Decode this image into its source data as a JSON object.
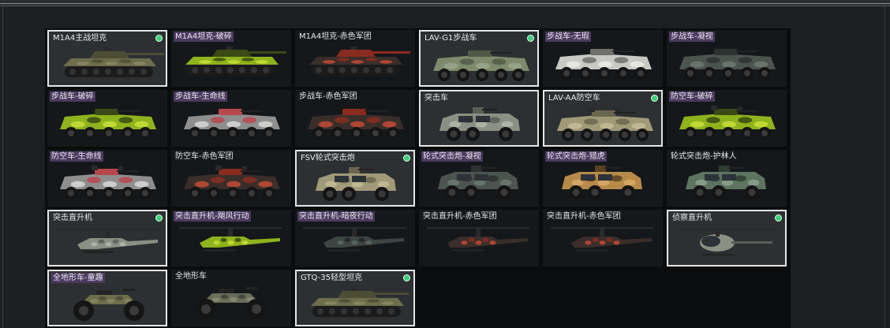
{
  "vehicles": [
    {
      "name": "M1A4主战坦克",
      "kind": "tank",
      "camo": "olive",
      "selected": true,
      "equipped": true,
      "tagged": false
    },
    {
      "name": "M1A4坦克-破碎",
      "kind": "tank",
      "camo": "lime",
      "selected": false,
      "equipped": false,
      "tagged": true
    },
    {
      "name": "M1A4坦克-赤色军团",
      "kind": "tank",
      "camo": "red",
      "selected": false,
      "equipped": false,
      "tagged": false
    },
    {
      "name": "LAV-G1步战车",
      "kind": "ifv",
      "camo": "green",
      "selected": true,
      "equipped": true,
      "tagged": false
    },
    {
      "name": "步战车-无瑕",
      "kind": "ifv",
      "camo": "white",
      "selected": false,
      "equipped": false,
      "tagged": true
    },
    {
      "name": "步战车-凝视",
      "kind": "ifv",
      "camo": "dark",
      "selected": false,
      "equipped": false,
      "tagged": true
    },
    {
      "name": "步战车-破碎",
      "kind": "ifv",
      "camo": "lime",
      "selected": false,
      "equipped": false,
      "tagged": true
    },
    {
      "name": "步战车-生命线",
      "kind": "ifv",
      "camo": "lifeline",
      "selected": false,
      "equipped": false,
      "tagged": true
    },
    {
      "name": "步战车-赤色军团",
      "kind": "ifv",
      "camo": "red",
      "selected": false,
      "equipped": false,
      "tagged": false
    },
    {
      "name": "突击车",
      "kind": "assault",
      "camo": "grey",
      "selected": true,
      "equipped": false,
      "tagged": false
    },
    {
      "name": "LAV-AA防空车",
      "kind": "aa",
      "camo": "tan",
      "selected": true,
      "equipped": true,
      "tagged": false
    },
    {
      "name": "防空车-破碎",
      "kind": "aa",
      "camo": "lime",
      "selected": false,
      "equipped": false,
      "tagged": true
    },
    {
      "name": "防空车-生命线",
      "kind": "aa",
      "camo": "lifeline",
      "selected": false,
      "equipped": false,
      "tagged": true
    },
    {
      "name": "防空车-赤色军团",
      "kind": "aa",
      "camo": "red",
      "selected": false,
      "equipped": false,
      "tagged": false
    },
    {
      "name": "FSV轮式突击炮",
      "kind": "fsv",
      "camo": "tan",
      "selected": true,
      "equipped": true,
      "tagged": false
    },
    {
      "name": "轮式突击炮-凝视",
      "kind": "fsv",
      "camo": "dark",
      "selected": false,
      "equipped": false,
      "tagged": true
    },
    {
      "name": "轮式突击炮-猎虎",
      "kind": "fsv",
      "camo": "tiger",
      "selected": false,
      "equipped": false,
      "tagged": true
    },
    {
      "name": "轮式突击炮-护林人",
      "kind": "fsv",
      "camo": "forest",
      "selected": false,
      "equipped": false,
      "tagged": false
    },
    {
      "name": "突击直升机",
      "kind": "heli",
      "camo": "grey",
      "selected": true,
      "equipped": true,
      "tagged": false
    },
    {
      "name": "突击直升机-飓风行动",
      "kind": "heli",
      "camo": "lime",
      "selected": false,
      "equipped": false,
      "tagged": true
    },
    {
      "name": "突击直升机-暗夜行动",
      "kind": "heli",
      "camo": "night",
      "selected": false,
      "equipped": false,
      "tagged": true
    },
    {
      "name": "突击直升机-赤色军团",
      "kind": "heli",
      "camo": "red",
      "selected": false,
      "equipped": false,
      "tagged": false
    },
    {
      "name": "突击直升机-赤色军团",
      "kind": "heli",
      "camo": "red",
      "selected": false,
      "equipped": false,
      "tagged": false
    },
    {
      "name": "侦察直升机",
      "kind": "scout",
      "camo": "grey",
      "selected": true,
      "equipped": true,
      "tagged": false
    },
    {
      "name": "全地形车-童趣",
      "kind": "atv",
      "camo": "olive",
      "selected": true,
      "equipped": false,
      "tagged": true
    },
    {
      "name": "全地形车",
      "kind": "atv",
      "camo": "greyolive",
      "selected": false,
      "equipped": false,
      "tagged": false
    },
    {
      "name": "GTQ-35轻型坦克",
      "kind": "light",
      "camo": "olive",
      "selected": true,
      "equipped": true,
      "tagged": false
    }
  ],
  "camo_colors": {
    "olive": [
      "#6e6d4c",
      "#4d4c35",
      "#8a8864"
    ],
    "lime": [
      "#8fb31c",
      "#3a4a14",
      "#c7df3a"
    ],
    "red": [
      "#3a2e2a",
      "#8a2b20",
      "#c44a35"
    ],
    "green": [
      "#7d8a6c",
      "#4f5a45",
      "#9aa68a"
    ],
    "white": [
      "#c8c8c4",
      "#6f6f6c",
      "#ecebe6"
    ],
    "dark": [
      "#4c5450",
      "#2c3230",
      "#6c7a70"
    ],
    "lifeline": [
      "#8e8e8e",
      "#b8474c",
      "#d8d8d6"
    ],
    "grey": [
      "#8c9084",
      "#5a5e56",
      "#b4b8aa"
    ],
    "tan": [
      "#a09a78",
      "#6b664f",
      "#c4bc96"
    ],
    "tiger": [
      "#b88a4a",
      "#5b4022",
      "#d8aa6a"
    ],
    "forest": [
      "#5d7460",
      "#2f3d32",
      "#8da28e"
    ],
    "night": [
      "#3d4542",
      "#1f2523",
      "#5b6863"
    ],
    "greyolive": [
      "#6a6d58",
      "#3e4136",
      "#8a8d78"
    ]
  },
  "equipped_color": "#3fd07a",
  "tag_color": "#4b3a5e"
}
